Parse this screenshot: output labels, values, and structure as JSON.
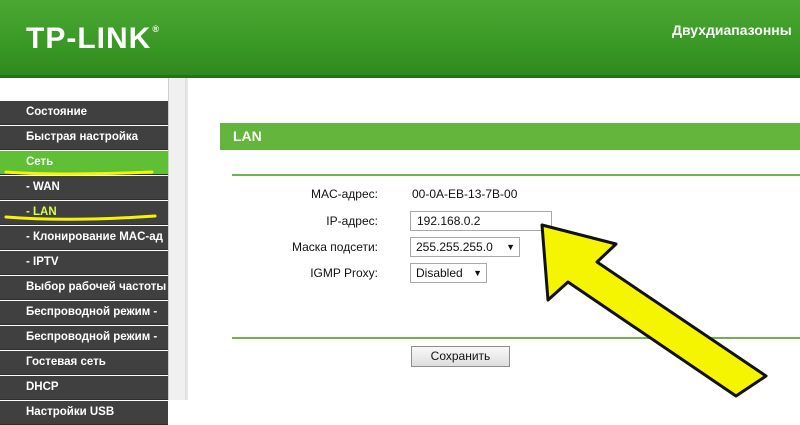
{
  "header": {
    "logo": "TP-LINK",
    "logo_mark": "®",
    "title": "Двухдиапазонны"
  },
  "sidebar": {
    "items": [
      {
        "label": "Состояние"
      },
      {
        "label": "Быстрая настройка"
      },
      {
        "label": "Сеть"
      },
      {
        "label": "- WAN"
      },
      {
        "label": "- LAN"
      },
      {
        "label": "- Клонирование MAC-ад"
      },
      {
        "label": "- IPTV"
      },
      {
        "label": "Выбор рабочей частоты"
      },
      {
        "label": "Беспроводной режим -"
      },
      {
        "label": "Беспроводной режим -"
      },
      {
        "label": "Гостевая сеть"
      },
      {
        "label": "DHCP"
      },
      {
        "label": "Настройки USB"
      }
    ]
  },
  "section": {
    "title": "LAN"
  },
  "form": {
    "mac_label": "MAC-адрес:",
    "mac_value": "00-0A-EB-13-7B-00",
    "ip_label": "IP-адрес:",
    "ip_value": "192.168.0.2",
    "mask_label": "Маска подсети:",
    "mask_value": "255.255.255.0",
    "igmp_label": "IGMP Proxy:",
    "igmp_value": "Disabled",
    "save_label": "Сохранить"
  },
  "colors": {
    "brand_green": "#3b9a26",
    "active_green": "#5fbf35",
    "highlight_yellow": "#f5f500"
  },
  "icons": {
    "annotation": "yellow-arrow-icon",
    "dropdown": "triangle-down-icon"
  }
}
